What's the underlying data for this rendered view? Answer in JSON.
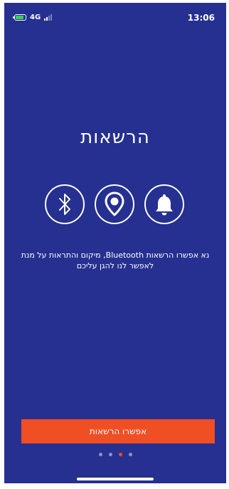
{
  "status_bar": {
    "network": "4G",
    "time": "13:06"
  },
  "page": {
    "title": "הרשאות",
    "description_line1": "נא אפשרו הרשאות Bluetooth, מיקום והתראות על מנת",
    "description_line2": "לאפשר לנו להגן עליכם"
  },
  "icons": [
    "bluetooth-icon",
    "location-pin-icon",
    "bell-icon"
  ],
  "button": {
    "label": "אפשרו הרשאות"
  },
  "pagination": {
    "total": 4,
    "active_index": 2
  },
  "colors": {
    "background": "#253090",
    "accent": "#f04e23",
    "text": "#ffffff",
    "battery": "#36d05a"
  }
}
